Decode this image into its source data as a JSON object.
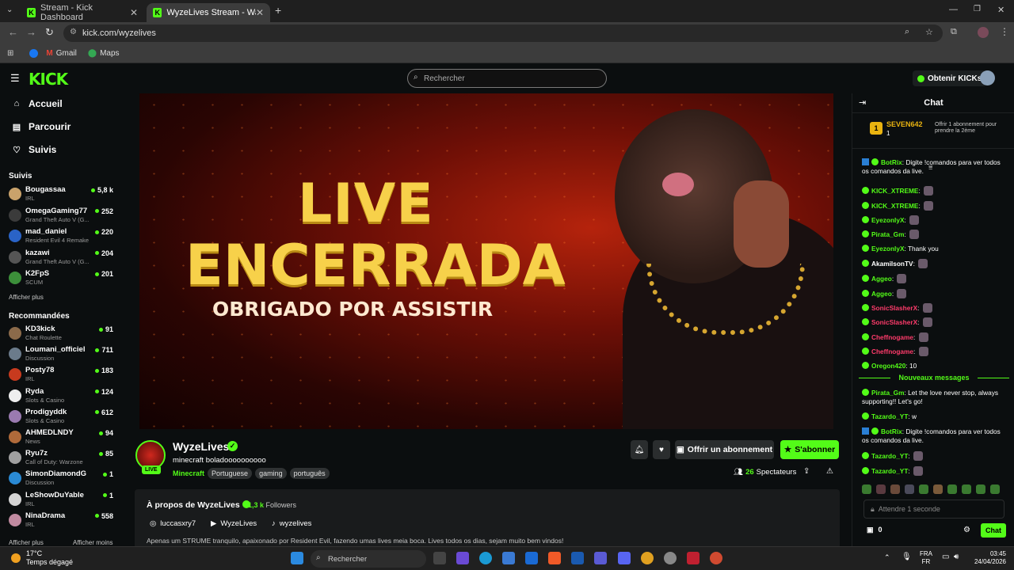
{
  "browser": {
    "tabs": [
      {
        "title": "Stream - Kick Dashboard"
      },
      {
        "title": "WyzeLives Stream - Watch Live"
      }
    ],
    "url": "kick.com/wyzelives",
    "bookmarks": [
      "Gmail",
      "Maps"
    ]
  },
  "header": {
    "logo": "KICK",
    "search_placeholder": "Rechercher",
    "get_kicks_label": "Obtenir KICKs"
  },
  "sidebar": {
    "nav": [
      {
        "label": "Accueil",
        "icon": "home-icon"
      },
      {
        "label": "Parcourir",
        "icon": "browse-icon"
      },
      {
        "label": "Suivis",
        "icon": "heart-icon"
      }
    ],
    "followed_title": "Suivis",
    "followed": [
      {
        "name": "Bougassaa",
        "category": "IRL",
        "viewers": "5,8 k",
        "color": "#c9a26b"
      },
      {
        "name": "OmegaGaming77",
        "category": "Grand Theft Auto V (G...",
        "viewers": "252",
        "color": "#3b3b3b"
      },
      {
        "name": "mad_daniel",
        "category": "Resident Evil 4 Remake",
        "viewers": "220",
        "color": "#2a63c7"
      },
      {
        "name": "kazawi",
        "category": "Grand Theft Auto V (G...",
        "viewers": "204",
        "color": "#555"
      },
      {
        "name": "K2FpS",
        "category": "SCUM",
        "viewers": "201",
        "color": "#3c8f3a"
      }
    ],
    "show_more": "Afficher plus",
    "recommended_title": "Recommandées",
    "recommended": [
      {
        "name": "KD3kick",
        "category": "Chat Roulette",
        "viewers": "91",
        "color": "#8b6a4a"
      },
      {
        "name": "Loumani_officiel",
        "category": "Discussion",
        "viewers": "711",
        "color": "#6b7b8b"
      },
      {
        "name": "Posty78",
        "category": "IRL",
        "viewers": "183",
        "color": "#c73a1e"
      },
      {
        "name": "Ryda",
        "category": "Slots & Casino",
        "viewers": "124",
        "color": "#eeeeee"
      },
      {
        "name": "Prodigyddk",
        "category": "Slots & Casino",
        "viewers": "612",
        "color": "#9a7ab0"
      },
      {
        "name": "AHMEDLNDY",
        "category": "News",
        "viewers": "94",
        "color": "#b06a3a"
      },
      {
        "name": "Ryu7z",
        "category": "Call of Duty: Warzone",
        "viewers": "85",
        "color": "#a0a0a0"
      },
      {
        "name": "SimonDiamondG",
        "category": "Discussion",
        "viewers": "1",
        "color": "#2a8ad4"
      },
      {
        "name": "LeShowDuYable",
        "category": "IRL",
        "viewers": "1",
        "color": "#d4d4d4"
      },
      {
        "name": "NinaDrama",
        "category": "IRL",
        "viewers": "558",
        "color": "#c08aa0"
      }
    ],
    "show_more_2": "Afficher plus",
    "show_less": "Afficher moins"
  },
  "player": {
    "line1": "LIVE",
    "line2": "ENCERRADA",
    "line3": "OBRIGADO POR ASSISTIR"
  },
  "channel": {
    "name": "WyzeLives",
    "live_badge": "LIVE",
    "title": "minecraft  boladoooooooooo",
    "category": "Minecraft",
    "tags": [
      "Portuguese",
      "gaming",
      "português"
    ],
    "gift_label": "Offrir un abonnement",
    "subscribe_label": "S'abonner",
    "viewers_count": "26",
    "viewers_label": "Spectateurs"
  },
  "about": {
    "title": "À propos de WyzeLives",
    "followers_count": "1,3 k",
    "followers_label": "Followers",
    "instagram": "luccasxry7",
    "youtube": "WyzeLives",
    "tiktok": "wyzelives",
    "description": "Apenas um STRUME tranquilo, apaixonado por Resident Evil, fazendo umas lives meia boca. Lives todos os dias, sejam muito bem vindos!"
  },
  "chat": {
    "title": "Chat",
    "pinned": {
      "rank": "1",
      "user": "SEVEN642",
      "count": "1",
      "text": "Offrir 1 abonnement pour prendre la 2ème"
    },
    "messages": [
      {
        "user": "BotRix",
        "color": "#53fc18",
        "text": "Digite !comandos para ver todos os comandos da live.",
        "bot": true
      },
      {
        "user": "KICK_XTREME",
        "color": "#53fc18",
        "text": ""
      },
      {
        "user": "KICK_XTREME",
        "color": "#53fc18",
        "text": ""
      },
      {
        "user": "EyezonlyX",
        "color": "#53fc18",
        "text": ""
      },
      {
        "user": "Pirata_Gm",
        "color": "#53fc18",
        "text": ""
      },
      {
        "user": "EyezonlyX",
        "color": "#53fc18",
        "text": "Thank you"
      },
      {
        "user": "AkamilsonTV",
        "color": "#fff",
        "text": ""
      },
      {
        "user": "Aggeo",
        "color": "#53fc18",
        "text": ""
      },
      {
        "user": "Aggeo",
        "color": "#53fc18",
        "text": ""
      },
      {
        "user": "SonicSlasherX",
        "color": "#ff3b6b",
        "text": ""
      },
      {
        "user": "SonicSlasherX",
        "color": "#ff3b6b",
        "text": ""
      },
      {
        "user": "Cheffnogame",
        "color": "#ff3b6b",
        "text": ""
      },
      {
        "user": "Cheffnogame",
        "color": "#ff3b6b",
        "text": ""
      },
      {
        "user": "Oregon420",
        "color": "#53fc18",
        "text": "10"
      }
    ],
    "new_messages_label": "Nouveaux messages",
    "new_messages": [
      {
        "user": "Pirata_Gm",
        "color": "#53fc18",
        "text": "Let the love never stop, always supporting!! Let's go!"
      },
      {
        "user": "Tazardo_YT",
        "color": "#53fc18",
        "text": "w"
      },
      {
        "user": "BotRix",
        "color": "#53fc18",
        "text": "Digite !comandos para ver todos os comandos da live.",
        "bot": true
      },
      {
        "user": "Tazardo_YT",
        "color": "#53fc18",
        "text": ""
      },
      {
        "user": "Tazardo_YT",
        "color": "#53fc18",
        "text": ""
      }
    ],
    "input_placeholder": "Attendre 1 seconde",
    "kicks_balance": "0",
    "send_label": "Chat"
  },
  "taskbar": {
    "temperature": "17°C",
    "weather": "Temps dégagé",
    "search_placeholder": "Rechercher",
    "lang_1": "FRA",
    "lang_2": "FR",
    "time": "03:45",
    "date": "24/04/2026"
  }
}
